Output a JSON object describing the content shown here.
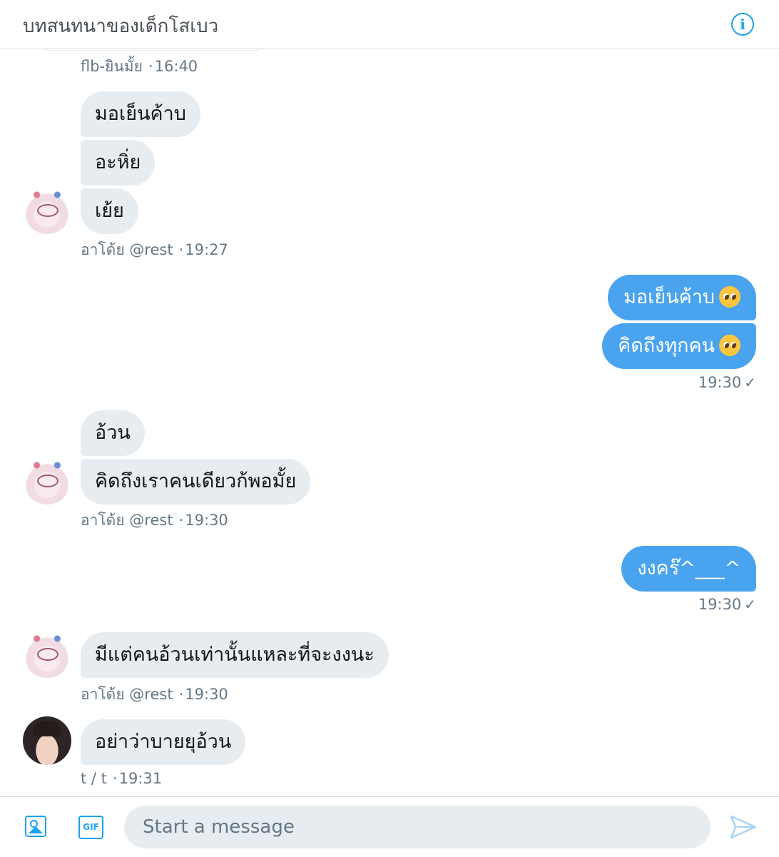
{
  "header": {
    "title": "บทสนทนาของเด็กโสเบว",
    "info_icon": "info-icon"
  },
  "messages": {
    "g1": {
      "meta_name": "flb-ยินมั้ย",
      "meta_time": "16:40"
    },
    "g2": {
      "b1": "มอเย็นค้าบ",
      "b2": "อะหิ่ย",
      "b3": "เย้ย",
      "meta_name": "อาโด้ย @rest",
      "meta_time": "19:27"
    },
    "g3": {
      "b1": "มอเย็นค้าบ",
      "b2": "คิดถึงทุกคน",
      "emoji": "pleading-face-emoji",
      "meta_time": "19:30",
      "check": "✓"
    },
    "g4": {
      "b1": "อ้วน",
      "b2": "คิดถึงเราคนเดียวก้พอมั้ย",
      "meta_name": "อาโด้ย @rest",
      "meta_time": "19:30"
    },
    "g5": {
      "b1": "งงคร๊^___^",
      "meta_time": "19:30",
      "check": "✓"
    },
    "g6": {
      "b1": "มีแต่คนอ้วนเท่านั้นแหละที่จะงงนะ",
      "meta_name": "อาโด้ย @rest",
      "meta_time": "19:30"
    },
    "g7": {
      "b1": "อย่าว่าบายยุอ้วน",
      "meta_name": "t / t",
      "meta_time": "19:31"
    }
  },
  "dot": "·",
  "composer": {
    "placeholder": "Start a message",
    "gif_label": "GIF",
    "image_icon": "image-icon",
    "send_icon": "send-icon"
  },
  "colors": {
    "accent": "#1da1f2",
    "outgoing_bubble": "#4aa3ee",
    "incoming_bubble": "#e6ecf0",
    "meta_text": "#657786"
  }
}
